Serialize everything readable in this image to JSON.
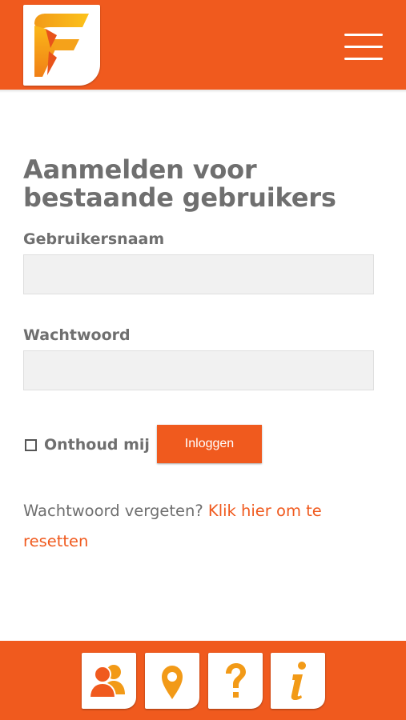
{
  "header": {
    "logo_icon": "orange-f-logo-icon",
    "menu_icon": "hamburger-menu-icon"
  },
  "login": {
    "title": "Aanmelden voor bestaande gebruikers",
    "username_label": "Gebruikersnaam",
    "username_value": "",
    "password_label": "Wachtwoord",
    "password_value": "",
    "remember_label": "Onthoud mij",
    "remember_checked": false,
    "login_button": "Inloggen",
    "forgot_text": "Wachtwoord vergeten?",
    "forgot_link": "Klik hier om te resetten"
  },
  "footer": {
    "tabs": [
      {
        "icon": "people-icon"
      },
      {
        "icon": "location-pin-icon"
      },
      {
        "icon": "help-icon"
      },
      {
        "icon": "info-icon"
      }
    ]
  },
  "colors": {
    "accent": "#f05a1e",
    "logo_yellow": "#fbbf1a",
    "text_gray": "#6f6f6f",
    "input_bg": "#f1f1f1"
  }
}
